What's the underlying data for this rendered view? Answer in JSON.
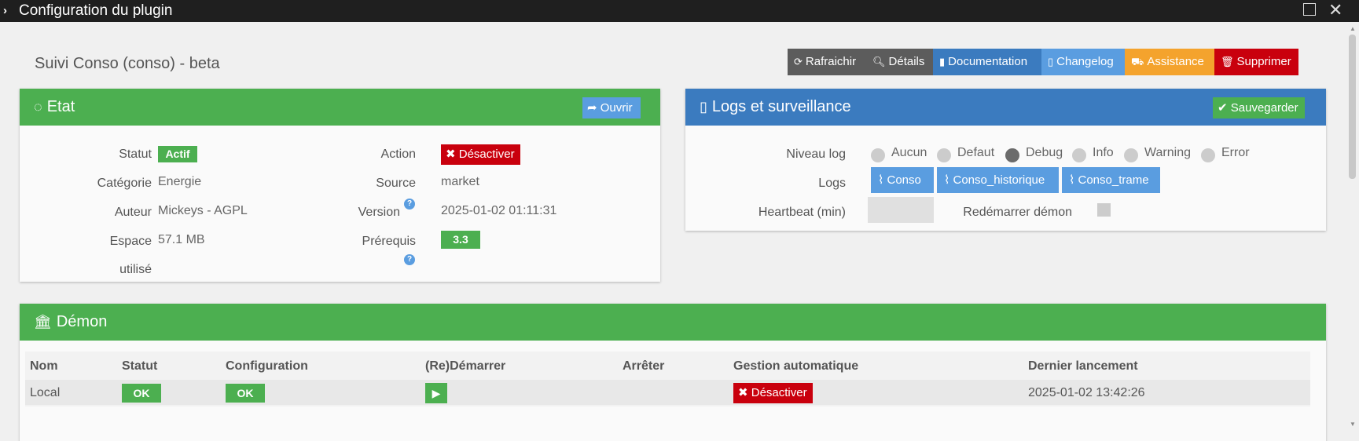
{
  "window": {
    "title": "Configuration du plugin"
  },
  "plugin": {
    "title": "Suivi Conso (conso) - beta"
  },
  "toolbar": {
    "refresh": "Rafraichir",
    "details": "Détails",
    "documentation": "Documentation",
    "changelog": "Changelog",
    "assistance": "Assistance",
    "delete": "Supprimer"
  },
  "etat": {
    "title": "Etat",
    "open_label": "Ouvrir",
    "statut_label": "Statut",
    "statut_value": "Actif",
    "categorie_label": "Catégorie",
    "categorie_value": "Energie",
    "auteur_label": "Auteur",
    "auteur_value": "Mickeys - AGPL",
    "espace_label_1": "Espace",
    "espace_label_2": "utilisé",
    "espace_value": "57.1 MB",
    "action_label": "Action",
    "action_value": "Désactiver",
    "source_label": "Source",
    "source_value": "market",
    "version_label": "Version",
    "version_value": "2025-01-02 01:11:31",
    "prerequis_label": "Prérequis",
    "prerequis_value": "3.3"
  },
  "logs": {
    "title": "Logs et surveillance",
    "save_label": "Sauvegarder",
    "niveau_label": "Niveau log",
    "levels": [
      "Aucun",
      "Defaut",
      "Debug",
      "Info",
      "Warning",
      "Error"
    ],
    "selected_level": "Debug",
    "logs_label": "Logs",
    "log_buttons": [
      "Conso",
      "Conso_historique",
      "Conso_trame"
    ],
    "heartbeat_label": "Heartbeat (min)",
    "heartbeat_value": "",
    "restart_label": "Redémarrer démon",
    "restart_checked": false
  },
  "demon": {
    "title": "Démon",
    "columns": [
      "Nom",
      "Statut",
      "Configuration",
      "(Re)Démarrer",
      "Arrêter",
      "Gestion automatique",
      "Dernier lancement"
    ],
    "row": {
      "nom": "Local",
      "statut": "OK",
      "configuration": "OK",
      "gestion": "Désactiver",
      "dernier": "2025-01-02 13:42:26"
    }
  },
  "colors": {
    "green": "#4caf50",
    "blue": "#3b7bbf",
    "light_blue": "#5a9de0",
    "grey_btn": "#5c5c5c",
    "orange": "#f4a32d",
    "red": "#c9000d"
  }
}
